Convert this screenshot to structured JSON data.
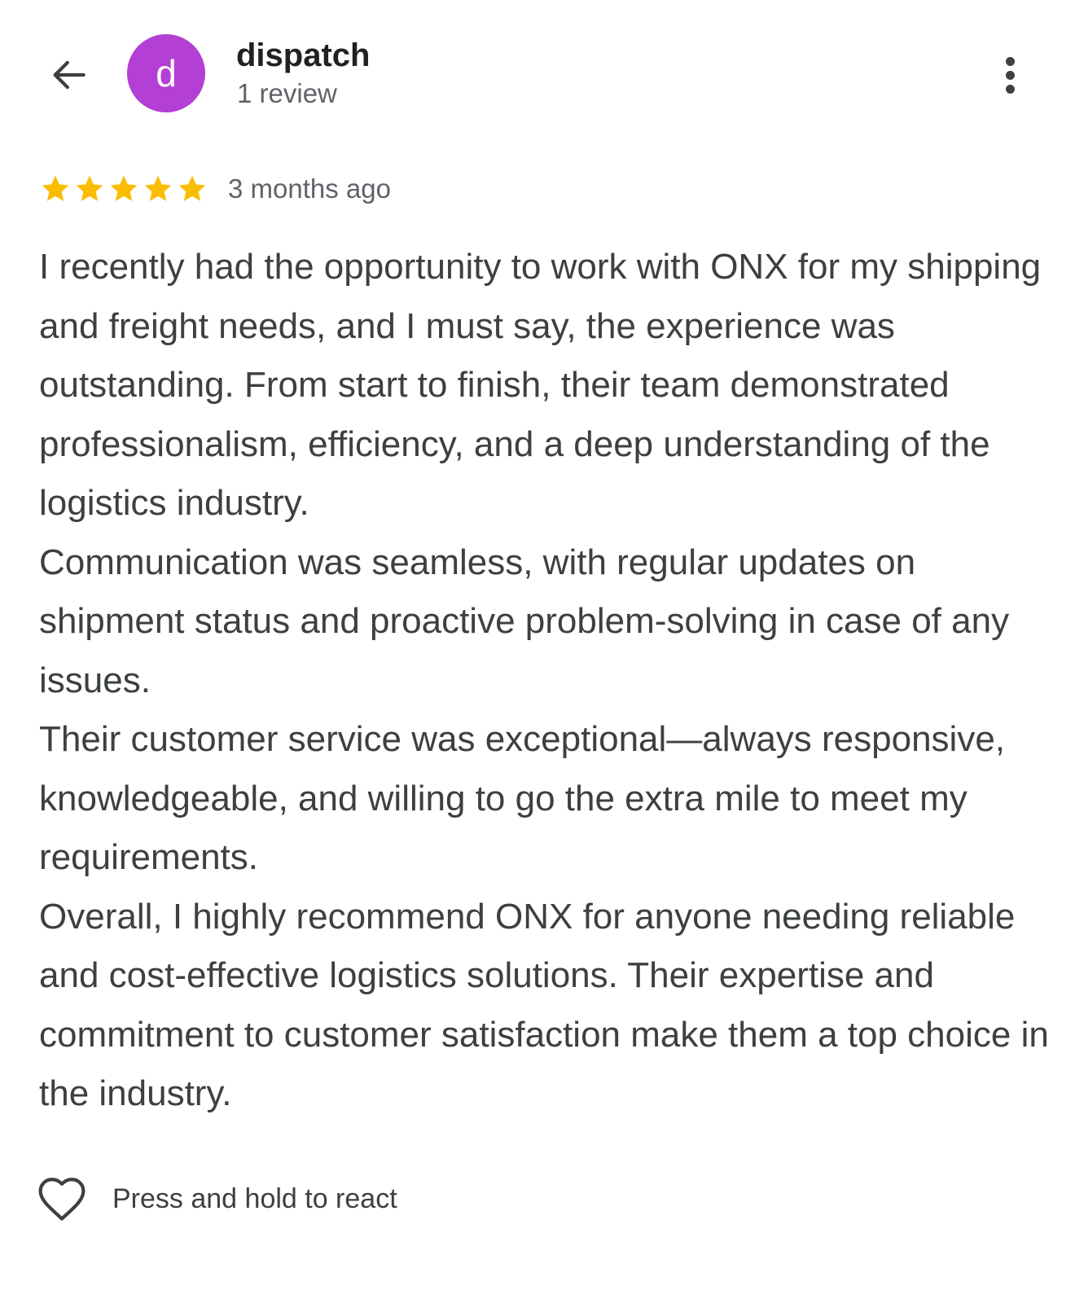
{
  "header": {
    "back_icon": "arrow-left-icon",
    "avatar_letter": "d",
    "avatar_color": "#b43fd4",
    "author_name": "dispatch",
    "author_meta": "1 review",
    "more_icon": "more-vertical-icon"
  },
  "review": {
    "rating": 5,
    "rating_max": 5,
    "star_color": "#fbbc04",
    "timestamp": "3 months ago",
    "paragraphs": [
      "I recently had the opportunity to work with ONX for my shipping and freight needs, and I must say, the experience was outstanding. From start to finish, their team demonstrated professionalism, efficiency, and a deep understanding of the logistics industry.",
      "Communication was seamless, with regular updates on shipment status and proactive problem-solving in case of any issues.",
      "Their customer service was exceptional—always responsive, knowledgeable, and willing to go the extra mile to meet my requirements.",
      "Overall, I highly recommend ONX for anyone needing reliable and cost-effective logistics solutions. Their expertise and commitment to customer satisfaction make them a top choice in the industry."
    ]
  },
  "reaction": {
    "icon": "heart-outline-icon",
    "label": "Press and hold to react"
  }
}
